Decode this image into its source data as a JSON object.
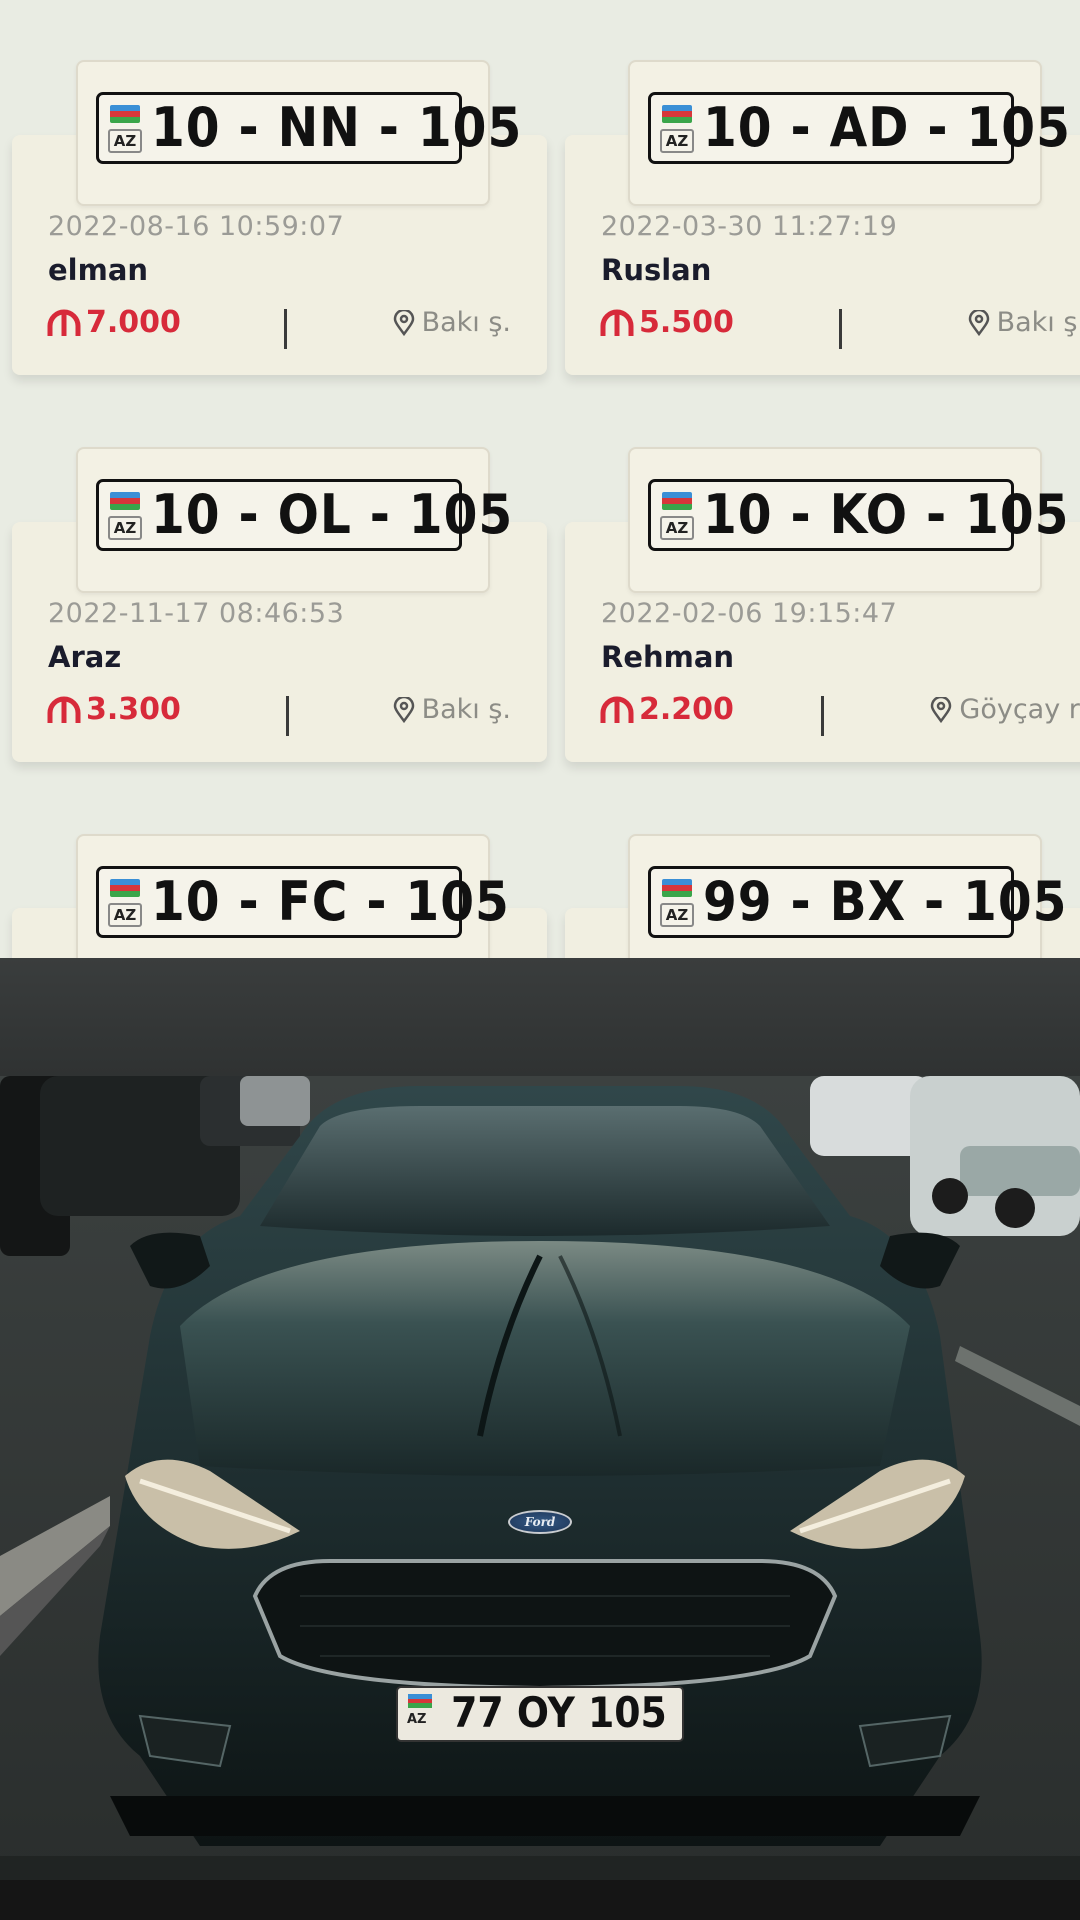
{
  "listings": [
    {
      "plate_region": "AZ",
      "plate": "10-NN-105",
      "date": "2022-08-16 10:59:07",
      "name": "elman",
      "price": "7.000",
      "location": "Bakı ş."
    },
    {
      "plate_region": "AZ",
      "plate": "10-AD-105",
      "date": "2022-03-30 11:27:19",
      "name": "Ruslan",
      "price": "5.500",
      "location": "Bakı ş."
    },
    {
      "plate_region": "AZ",
      "plate": "10-OL-105",
      "date": "2022-11-17 08:46:53",
      "name": "Araz",
      "price": "3.300",
      "location": "Bakı ş."
    },
    {
      "plate_region": "AZ",
      "plate": "10-KO-105",
      "date": "2022-02-06 19:15:47",
      "name": "Rehman",
      "price": "2.200",
      "location": "Göyçay r."
    },
    {
      "plate_region": "AZ",
      "plate": "10-FC-105"
    },
    {
      "plate_region": "AZ",
      "plate": "99-BX-105"
    }
  ],
  "photo": {
    "badge": "Ford",
    "plate_region": "AZ",
    "plate": "77 OY 105"
  },
  "icons": {
    "currency": "manat-icon",
    "location": "map-pin-icon"
  },
  "colors": {
    "price": "#d72a3a",
    "background": "#e9ece3",
    "card": "#f1efe1"
  }
}
